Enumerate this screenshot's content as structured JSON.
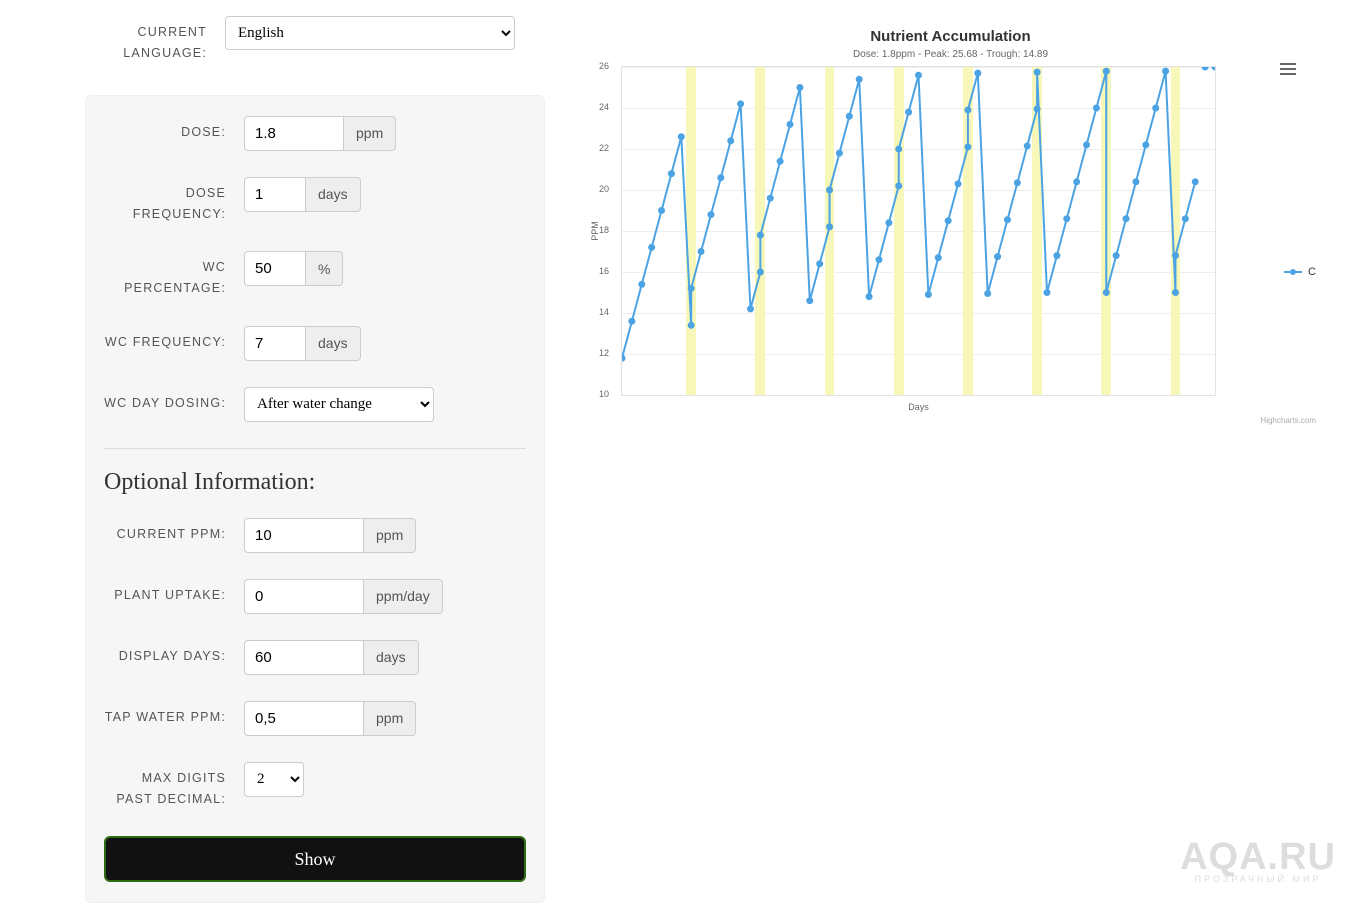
{
  "language": {
    "label": "CURRENT LANGUAGE:",
    "value": "English",
    "options": [
      "English"
    ]
  },
  "form": {
    "dose": {
      "label": "DOSE:",
      "value": "1.8",
      "unit": "ppm"
    },
    "dose_freq": {
      "label": "DOSE FREQUENCY:",
      "value": "1",
      "unit": "days"
    },
    "wc_pct": {
      "label": "WC PERCENTAGE:",
      "value": "50",
      "unit": "%"
    },
    "wc_freq": {
      "label": "WC FREQUENCY:",
      "value": "7",
      "unit": "days"
    },
    "wc_day_dose": {
      "label": "WC DAY DOSING:",
      "value": "After water change"
    },
    "optional_heading": "Optional Information:",
    "current_ppm": {
      "label": "CURRENT PPM:",
      "value": "10",
      "unit": "ppm"
    },
    "plant_uptake": {
      "label": "PLANT UPTAKE:",
      "value": "0",
      "unit": "ppm/day"
    },
    "display_days": {
      "label": "DISPLAY DAYS:",
      "value": "60",
      "unit": "days"
    },
    "tap_water": {
      "label": "TAP WATER PPM:",
      "value": "0,5",
      "unit": "ppm"
    },
    "max_digits": {
      "label": "MAX DIGITS PAST DECIMAL:",
      "value": "2",
      "options": [
        "2"
      ]
    },
    "submit": "Show"
  },
  "chart_data": {
    "type": "line",
    "title": "Nutrient Accumulation",
    "subtitle": "Dose: 1.8ppm - Peak: 25.68 - Trough: 14.89",
    "xlabel": "Days",
    "ylabel": "PPM",
    "yticks": [
      10,
      12,
      14,
      16,
      18,
      20,
      22,
      24,
      26
    ],
    "ylim": [
      10,
      26
    ],
    "x_range": 60,
    "wc_days": [
      7,
      14,
      21,
      28,
      35,
      42,
      49,
      56
    ],
    "series": [
      {
        "name": "C",
        "color": "#4ba3e3",
        "x": [
          0,
          1,
          2,
          3,
          4,
          5,
          6,
          7,
          7,
          8,
          9,
          10,
          11,
          12,
          13,
          14,
          14,
          15,
          16,
          17,
          18,
          19,
          20,
          21,
          21,
          22,
          23,
          24,
          25,
          26,
          27,
          28,
          28,
          29,
          30,
          31,
          32,
          33,
          34,
          35,
          35,
          36,
          37,
          38,
          39,
          40,
          41,
          42,
          42,
          43,
          44,
          45,
          46,
          47,
          48,
          49,
          49,
          50,
          51,
          52,
          53,
          54,
          55,
          56,
          56,
          57,
          58,
          59,
          60
        ],
        "y": [
          11.8,
          13.6,
          15.4,
          17.2,
          19.0,
          20.8,
          22.6,
          13.4,
          15.2,
          17.0,
          18.8,
          20.6,
          22.4,
          24.2,
          14.2,
          16.0,
          17.8,
          19.6,
          21.4,
          23.2,
          25.0,
          14.6,
          16.4,
          18.2,
          20.0,
          21.8,
          23.6,
          25.4,
          14.8,
          16.6,
          18.4,
          20.2,
          22.0,
          23.8,
          25.6,
          14.9,
          16.7,
          18.5,
          20.3,
          22.1,
          23.9,
          25.7,
          14.95,
          16.75,
          18.55,
          20.35,
          22.15,
          23.95,
          25.75,
          15.0,
          16.8,
          18.6,
          20.4,
          22.2,
          24.0,
          25.8,
          15.0,
          16.8,
          18.6,
          20.4,
          22.2,
          24.0,
          25.8,
          15.0,
          16.8,
          18.6,
          20.4
        ]
      }
    ],
    "credits": "Highcharts.com",
    "legend_pos": "right"
  },
  "watermark": {
    "big": "AQA.RU",
    "small": "ПРОЗРАЧНЫЙ МИР"
  }
}
